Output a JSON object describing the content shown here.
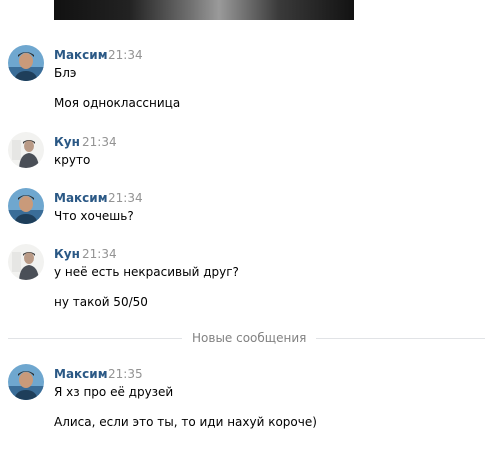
{
  "messages": [
    {
      "author": "Максим",
      "time": "21:34",
      "avatar": "maksim",
      "lines": [
        "Блэ",
        "Моя одноклассница"
      ]
    },
    {
      "author": "Кун",
      "time": "21:34",
      "avatar": "kun",
      "lines": [
        "круто"
      ]
    },
    {
      "author": "Максим",
      "time": "21:34",
      "avatar": "maksim",
      "lines": [
        "Что хочешь?"
      ]
    },
    {
      "author": "Кун",
      "time": "21:34",
      "avatar": "kun",
      "lines": [
        "у неё есть некрасивый друг?",
        "ну такой 50/50"
      ]
    },
    {
      "author": "Максим",
      "time": "21:35",
      "avatar": "maksim",
      "lines": [
        "Я хз про её друзей",
        "Алиса, если это ты, то иди нахуй короче)"
      ]
    }
  ],
  "divider": {
    "label": "Новые сообщения"
  },
  "colors": {
    "author_link": "#2a5885",
    "timestamp": "#939393",
    "divider_text": "#828282",
    "divider_line": "#e1e3e6"
  }
}
